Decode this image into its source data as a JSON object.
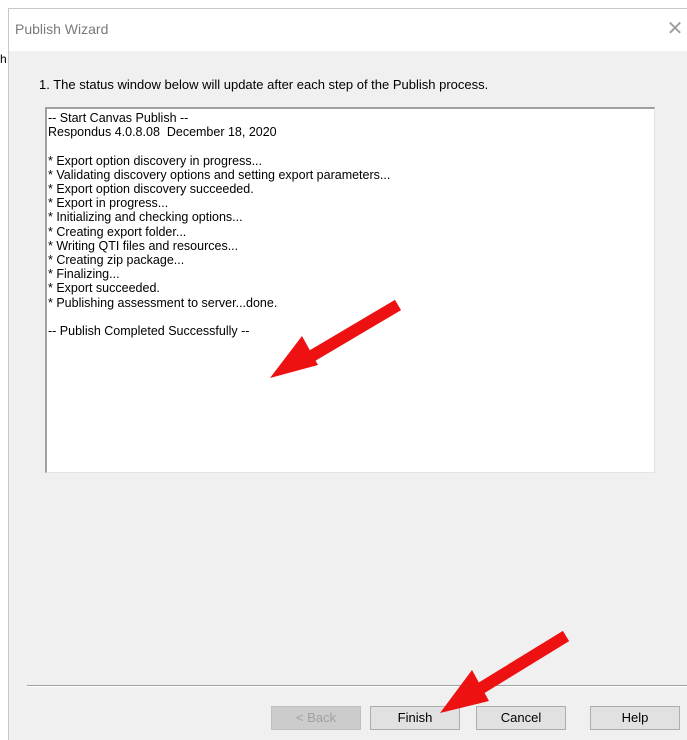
{
  "window": {
    "title": "Publish Wizard",
    "close_glyph": "✕"
  },
  "left_edge_char": "h",
  "instruction": "1.  The status window below will update after each step of the Publish process.",
  "status_lines": [
    "-- Start Canvas Publish --",
    "Respondus 4.0.8.08  December 18, 2020",
    "",
    "* Export option discovery in progress...",
    "* Validating discovery options and setting export parameters...",
    "* Export option discovery succeeded.",
    "* Export in progress...",
    "* Initializing and checking options...",
    "* Creating export folder...",
    "* Writing QTI files and resources...",
    "* Creating zip package...",
    "* Finalizing...",
    "* Export succeeded.",
    "* Publishing assessment to server...done.",
    "",
    "-- Publish Completed Successfully --"
  ],
  "buttons": {
    "back": "< Back",
    "finish": "Finish",
    "cancel": "Cancel",
    "help": "Help"
  },
  "colors": {
    "annotation_arrow": "#ee1111",
    "dialog_background": "#f0f0f0"
  },
  "icons": {
    "close": "close-icon",
    "annotation": "red-arrow-icon"
  }
}
